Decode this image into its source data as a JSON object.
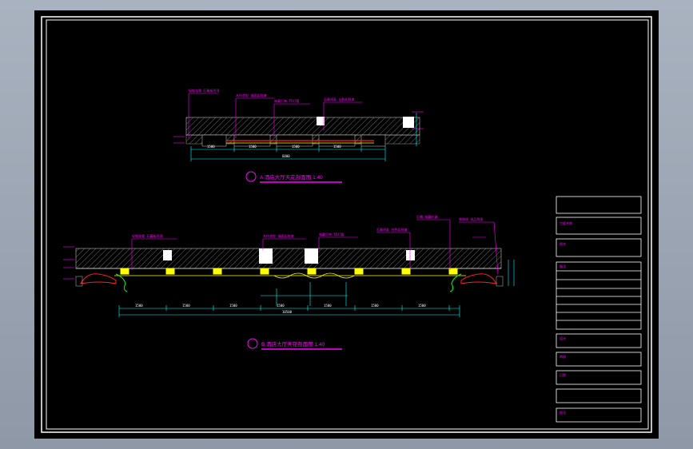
{
  "drawing": {
    "section1": {
      "title": "A 酒店大厅天花剖面图 1:40"
    },
    "section2": {
      "title": "B 酒店大厅天花剖面图 1:40"
    }
  },
  "title_block": {
    "fields": [
      {
        "label": "工程名称",
        "value": ""
      },
      {
        "label": "图名",
        "value": ""
      },
      {
        "label": "备注",
        "value": ""
      },
      {
        "label": "设计",
        "value": ""
      },
      {
        "label": "审核",
        "value": ""
      },
      {
        "label": "日期",
        "value": ""
      },
      {
        "label": "图号",
        "value": ""
      }
    ]
  },
  "colors": {
    "sheet": "#000000",
    "frame": "#ffffff",
    "annotation": "#ff00ff",
    "dimension": "#00ffff",
    "detail": "#ffff00",
    "moulding": "#ff0000",
    "hatch": "#aaaaaa"
  }
}
